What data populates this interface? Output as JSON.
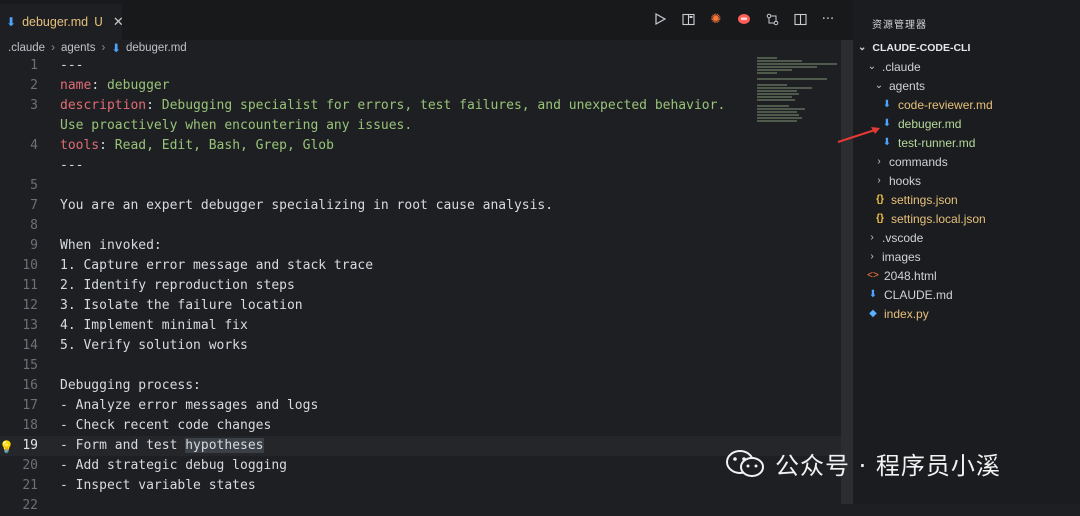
{
  "tab": {
    "filename": "debuger.md",
    "status": "U"
  },
  "toolbar": {
    "icons": [
      "run-icon",
      "split-preview-icon",
      "sparkle-icon",
      "chat-icon",
      "compare-icon",
      "split-editor-icon",
      "more-icon"
    ],
    "more_label": "···"
  },
  "breadcrumb": {
    "items": [
      ".claude",
      "agents",
      "debuger.md"
    ],
    "sep": "›"
  },
  "code_lines": [
    {
      "n": "1",
      "text": "---"
    },
    {
      "n": "2",
      "key": "name",
      "val": "debugger"
    },
    {
      "n": "3",
      "key": "description",
      "val": "Debugging specialist for errors, test failures, and unexpected behavior."
    },
    {
      "n": "",
      "val": "Use proactively when encountering any issues."
    },
    {
      "n": "4",
      "key": "tools",
      "val": "Read, Edit, Bash, Grep, Glob"
    },
    {
      "n": "",
      "text": "---"
    },
    {
      "n": "5",
      "text": ""
    },
    {
      "n": "7",
      "text": "You are an expert debugger specializing in root cause analysis."
    },
    {
      "n": "8",
      "text": ""
    },
    {
      "n": "9",
      "text": "When invoked:"
    },
    {
      "n": "10",
      "text": "1. Capture error message and stack trace"
    },
    {
      "n": "11",
      "text": "2. Identify reproduction steps"
    },
    {
      "n": "12",
      "text": "3. Isolate the failure location"
    },
    {
      "n": "13",
      "text": "4. Implement minimal fix"
    },
    {
      "n": "14",
      "text": "5. Verify solution works"
    },
    {
      "n": "15",
      "text": ""
    },
    {
      "n": "16",
      "text": "Debugging process:"
    },
    {
      "n": "17",
      "text": "- Analyze error messages and logs"
    },
    {
      "n": "18",
      "text": "- Check recent code changes"
    },
    {
      "n": "19",
      "text": "- Form and test ",
      "sel": "hypotheses",
      "active": true
    },
    {
      "n": "20",
      "text": "- Add strategic debug logging"
    },
    {
      "n": "21",
      "text": "- Inspect variable states"
    },
    {
      "n": "22",
      "text": ""
    }
  ],
  "explorer": {
    "title": "资源管理器",
    "root": "CLAUDE-CODE-CLI",
    "tree": [
      {
        "label": ".claude",
        "indent": 1,
        "chev": "⌄",
        "kind": "folder"
      },
      {
        "label": "agents",
        "indent": 2,
        "chev": "⌄",
        "kind": "folder"
      },
      {
        "label": "code-reviewer.md",
        "indent": 3,
        "icon": "md",
        "color": "yellow"
      },
      {
        "label": "debuger.md",
        "indent": 3,
        "icon": "md",
        "color": "green"
      },
      {
        "label": "test-runner.md",
        "indent": 3,
        "icon": "md",
        "color": "green"
      },
      {
        "label": "commands",
        "indent": 2,
        "chev": "›",
        "kind": "folder"
      },
      {
        "label": "hooks",
        "indent": 2,
        "chev": "›",
        "kind": "folder"
      },
      {
        "label": "settings.json",
        "indent": 2,
        "icon": "json",
        "color": "yellow"
      },
      {
        "label": "settings.local.json",
        "indent": 2,
        "icon": "json",
        "color": "yellow"
      },
      {
        "label": ".vscode",
        "indent": 1,
        "chev": "›",
        "kind": "folder"
      },
      {
        "label": "images",
        "indent": 1,
        "chev": "›",
        "kind": "folder"
      },
      {
        "label": "2048.html",
        "indent": 1,
        "icon": "html",
        "color": "normal"
      },
      {
        "label": "CLAUDE.md",
        "indent": 1,
        "icon": "md",
        "color": "normal"
      },
      {
        "label": "index.py",
        "indent": 1,
        "icon": "py",
        "color": "yellow"
      }
    ]
  },
  "watermark": {
    "text": "公众号 · 程序员小溪",
    "icon": "wechat-icon"
  },
  "colors": {
    "accent": "#4da3ff",
    "key": "#e06c75",
    "value": "#98c379",
    "modified": "#e6c07b",
    "arrow": "#e53935"
  }
}
